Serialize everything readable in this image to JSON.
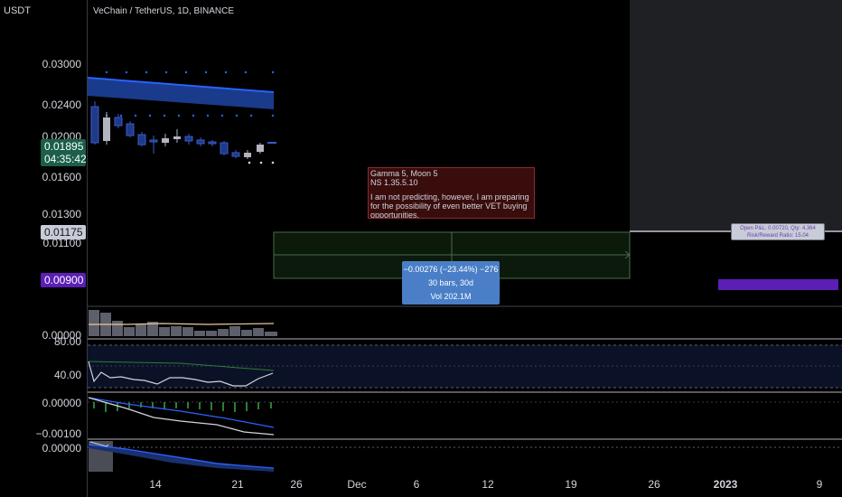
{
  "header": {
    "quote_currency": "USDT",
    "title": "VeChain / TetherUS, 1D, BINANCE"
  },
  "price_axis": {
    "labels": [
      "0.03000",
      "0.02400",
      "0.02000",
      "0.01600",
      "0.01300",
      "0.01100"
    ],
    "current_price": "0.01895",
    "countdown": "04:35:42",
    "line_price_tag": "0.01175",
    "target_tag": "0.00900"
  },
  "volume_pane": {
    "label": "0.00000"
  },
  "rsi_pane": {
    "labels": [
      "80.00",
      "40.00"
    ]
  },
  "macd_pane": {
    "labels": [
      "0.00000",
      "−0.00100"
    ]
  },
  "osc_pane": {
    "label": "0.00000"
  },
  "time_axis": [
    "14",
    "21",
    "26",
    "Dec",
    "6",
    "12",
    "19",
    "26",
    "2023",
    "9"
  ],
  "note": {
    "line1": "Gamma 5, Moon 5",
    "line2": "NS 1.35.5.10",
    "body": "I am not predicting, however, I am preparing for the possibility of even better VET buying opportunities."
  },
  "measure": {
    "line1": "−0.00276 (−23.44%) −276",
    "line2": "30 bars, 30d",
    "line3": "Vol 202.1M"
  },
  "position_tool": {
    "line1": "Open P&L: 0.00720, Qty: 4.364",
    "line2": "Risk/Reward Ratio: 15.04"
  },
  "colors": {
    "background": "#000000",
    "up_candle": "#b2b5be",
    "down_candle": "#1e3a8a",
    "current_price_bg": "#1b5e4a",
    "target_bg": "#5b1fb5",
    "note_bg": "#3a0d0d",
    "measure_bg": "#4a7fc7"
  }
}
